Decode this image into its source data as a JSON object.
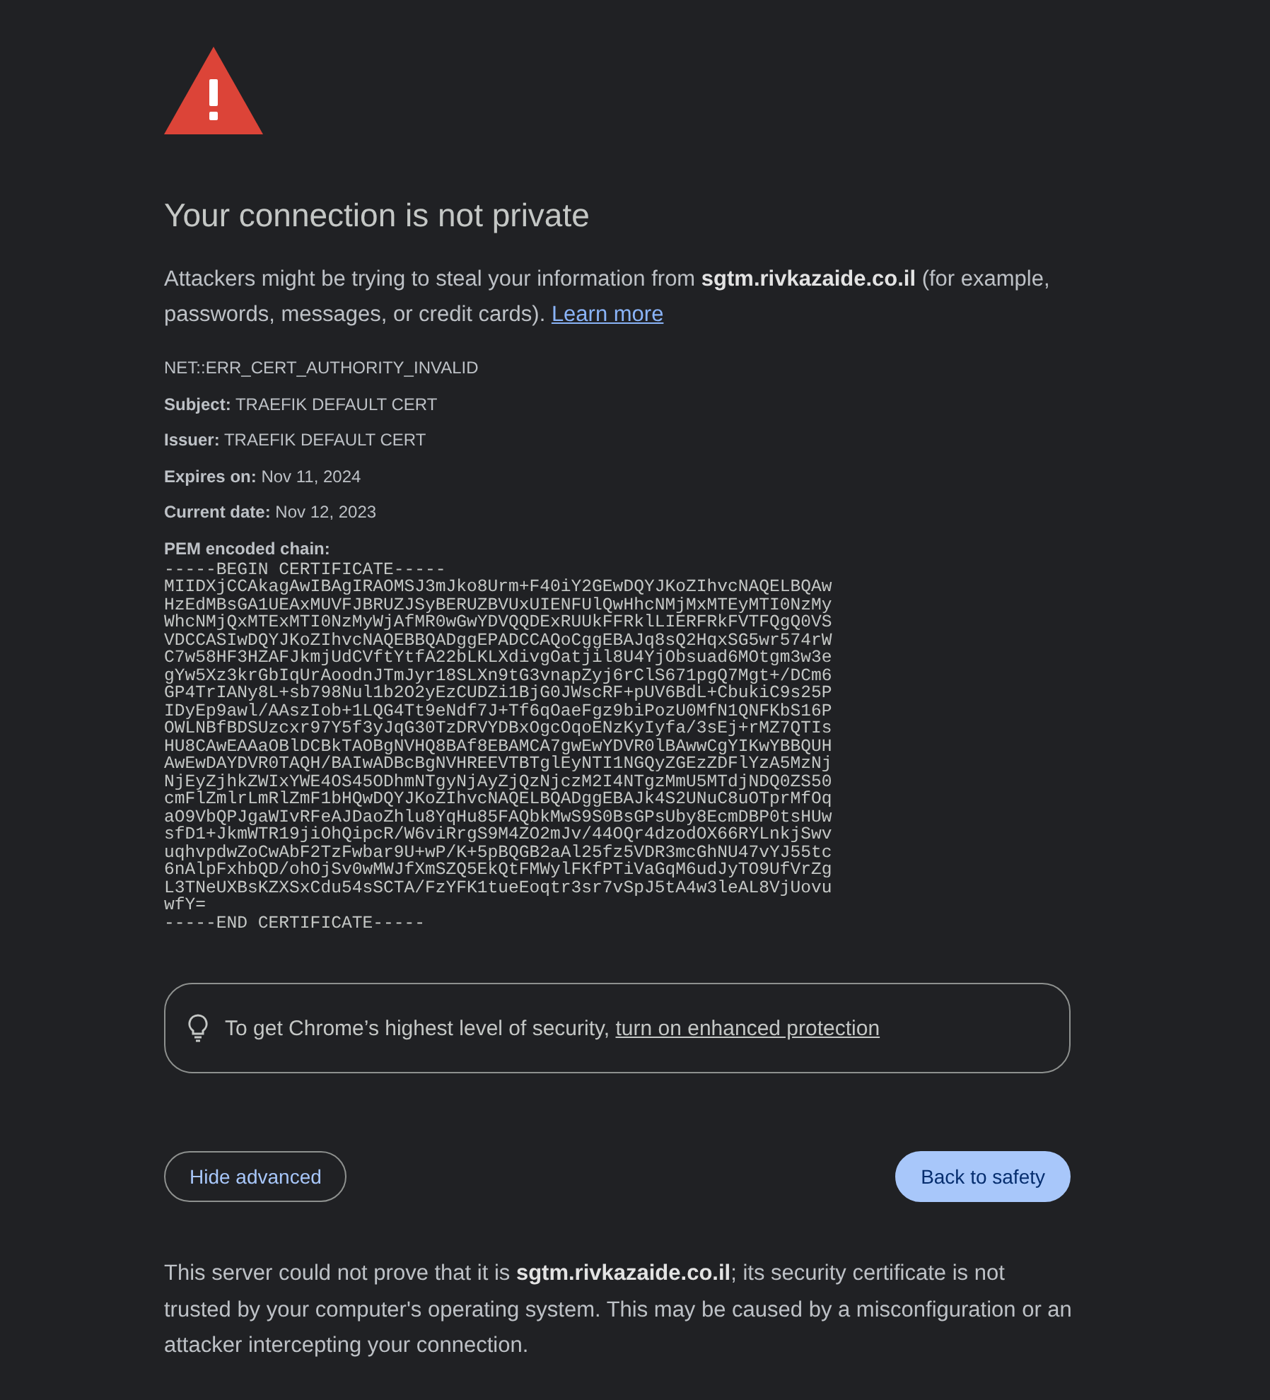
{
  "heading": "Your connection is not private",
  "intro": "Attackers might be trying to steal your information from **sgtm.rivkazaide.co.il** (for example, passwords, messages, or credit cards).",
  "learn_more_link": "Learn more",
  "error_code": "NET::ERR_CERT_AUTHORITY_INVALID",
  "details": [
    "**Subject:** TRAEFIK DEFAULT CERT",
    "**Issuer:** TRAEFIK DEFAULT CERT",
    "**Expires on:** Nov 11, 2024",
    "**Current date:** Nov 12, 2023"
  ],
  "pem_label": "PEM encoded chain:",
  "pem_lines": [
    "-----BEGIN CERTIFICATE-----",
    "MIIDXjCCAkagAwIBAgIRAOMSJ3mJko8Urm+F40iY2GEwDQYJKoZIhvcNAQELBQAw",
    "HzEdMBsGA1UEAxMUVFJBRUZJSyBERUZBVUxUIENFUlQwHhcNMjMxMTEyMTI0NzMy",
    "WhcNMjQxMTExMTI0NzMyWjAfMR0wGwYDVQQDExRUUkFFRklLIERFRkFVTFQgQ0VS",
    "VDCCASIwDQYJKoZIhvcNAQEBBQADggEPADCCAQoCggEBAJq8sQ2HqxSG5wr574rW",
    "C7w58HF3HZAFJkmjUdCVftYtfA22bLKLXdivgOatjil8U4YjObsuad6MOtgm3w3e",
    "gYw5Xz3krGbIqUrAoodnJTmJyr18SLXn9tG3vnapZyj6rClS671pgQ7Mgt+/DCm6",
    "GP4TrIANy8L+sb798Nul1b2O2yEzCUDZi1BjG0JWscRF+pUV6BdL+CbukiC9s25P",
    "IDyEp9awl/AAszIob+1LQG4Tt9eNdf7J+Tf6qOaeFgz9biPozU0MfN1QNFKbS16P",
    "OWLNBfBDSUzcxr97Y5f3yJqG30TzDRVYDBxOgcOqoENzKyIyfa/3sEj+rMZ7QTIs",
    "HU8CAwEAAaOBlDCBkTAOBgNVHQ8BAf8EBAMCA7gwEwYDVR0lBAwwCgYIKwYBBQUH",
    "AwEwDAYDVR0TAQH/BAIwADBcBgNVHREEVTBTglEyNTI1NGQyZGEzZDFlYzA5MzNj",
    "NjEyZjhkZWIxYWE4OS45ODhmNTgyNjAyZjQzNjczM2I4NTgzMmU5MTdjNDQ0ZS50",
    "cmFlZmlrLmRlZmF1bHQwDQYJKoZIhvcNAQELBQADggEBAJk4S2UNuC8uOTprMfOq",
    "aO9VbQPJgaWIvRFeAJDaoZhlu8YqHu85FAQbkMwS9S0BsGPsUby8EcmDBP0tsHUw",
    "sfD1+JkmWTR19jiOhQipcR/W6viRrgS9M4ZO2mJv/44OQr4dzodOX66RYLnkjSwv",
    "uqhvpdwZoCwAbF2TzFwbar9U+wP/K+5pBQGB2aAl25fz5VDR3mcGhNU47vYJ55tc",
    "6nAlpFxhbQD/ohOjSv0wMWJfXmSZQ5EkQtFMWylFKfPTiVaGqM6udJyTO9UfVrZg",
    "L3TNeUXBsKZXSxCdu54sSCTA/FzYFK1tueEoqtr3sr7vSpJ5tA4w3leAL8VjUovu",
    "wfY=",
    "-----END CERTIFICATE-----"
  ],
  "tip": {
    "text": "To get Chrome’s highest level of security,",
    "link": "turn on enhanced protection"
  },
  "buttons": [
    {
      "label": "Hide advanced",
      "kind": "secondary"
    },
    {
      "label": "Back to safety",
      "kind": "primary"
    }
  ],
  "explanation": "This server could not prove that it is **sgtm.rivkazaide.co.il**; its security certificate is not trusted by your computer's operating system. This may be caused by a misconfiguration or an attacker intercepting your connection."
}
